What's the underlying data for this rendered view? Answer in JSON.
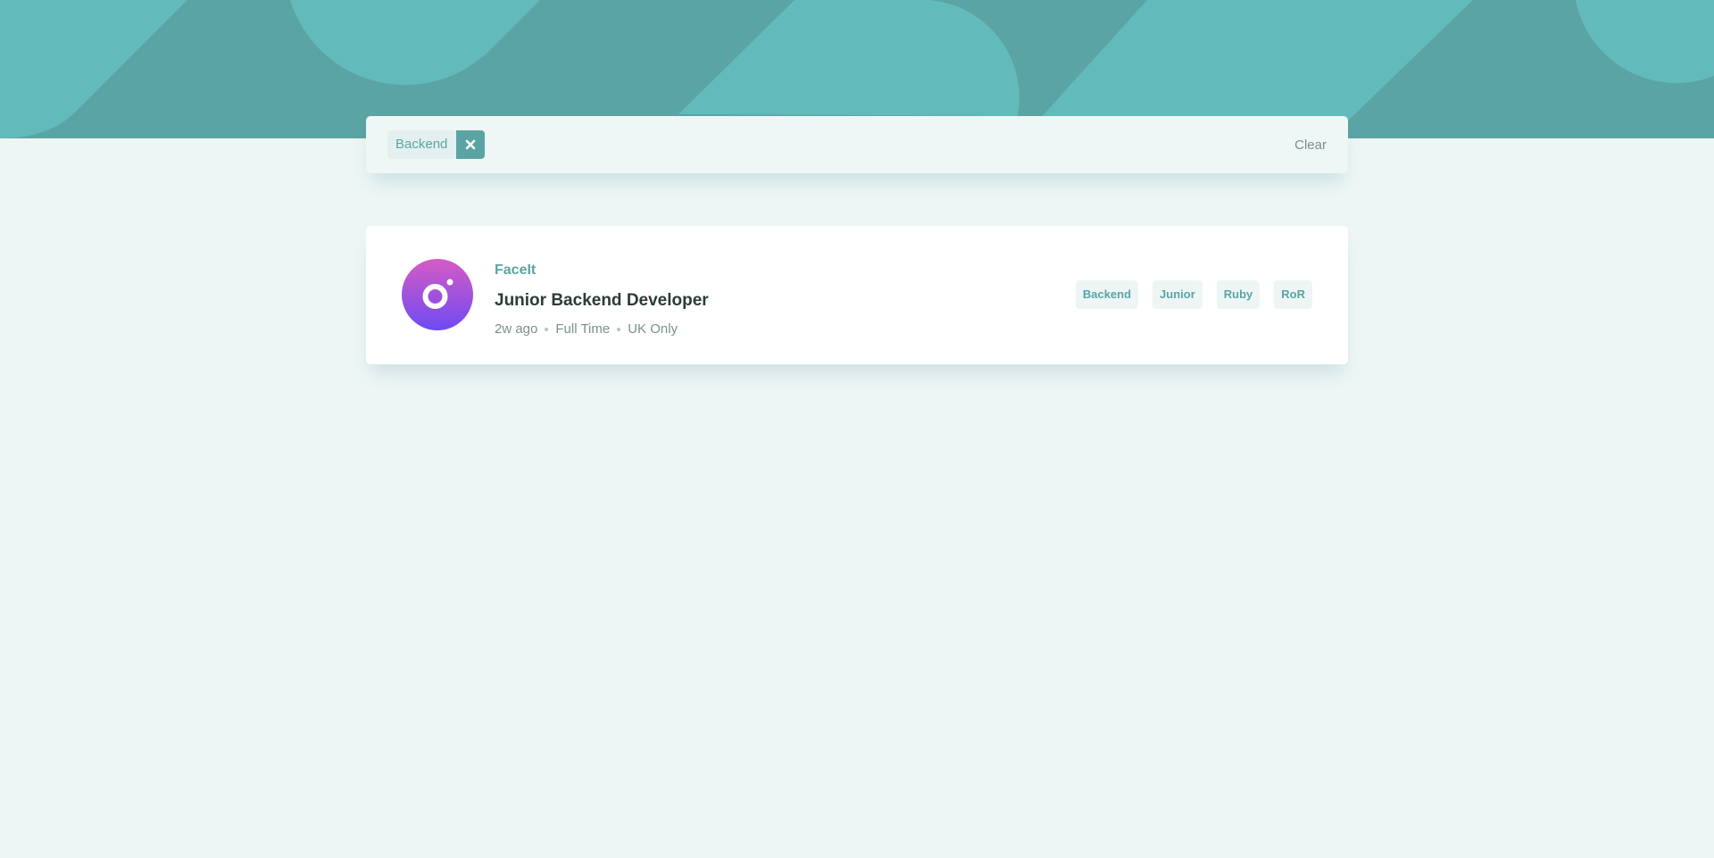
{
  "header": {
    "colors": {
      "base": "#5BA4A4",
      "shape": "#63BABA"
    }
  },
  "filter_bar": {
    "chips": [
      {
        "label": "Backend",
        "remove_icon": "close-icon"
      }
    ],
    "clear_label": "Clear"
  },
  "job": {
    "logo_icon": "photosnap-style-camera-logo",
    "company": "FaceIt",
    "position": "Junior Backend Developer",
    "posted": "2w ago",
    "contract": "Full Time",
    "location": "UK Only",
    "tags": [
      "Backend",
      "Junior",
      "Ruby",
      "RoR"
    ]
  },
  "colors": {
    "page_bg": "#EEF6F5",
    "primary": "#5BA4A4",
    "text_dark": "#2C3A3A",
    "text_muted": "#7C8F8F"
  }
}
